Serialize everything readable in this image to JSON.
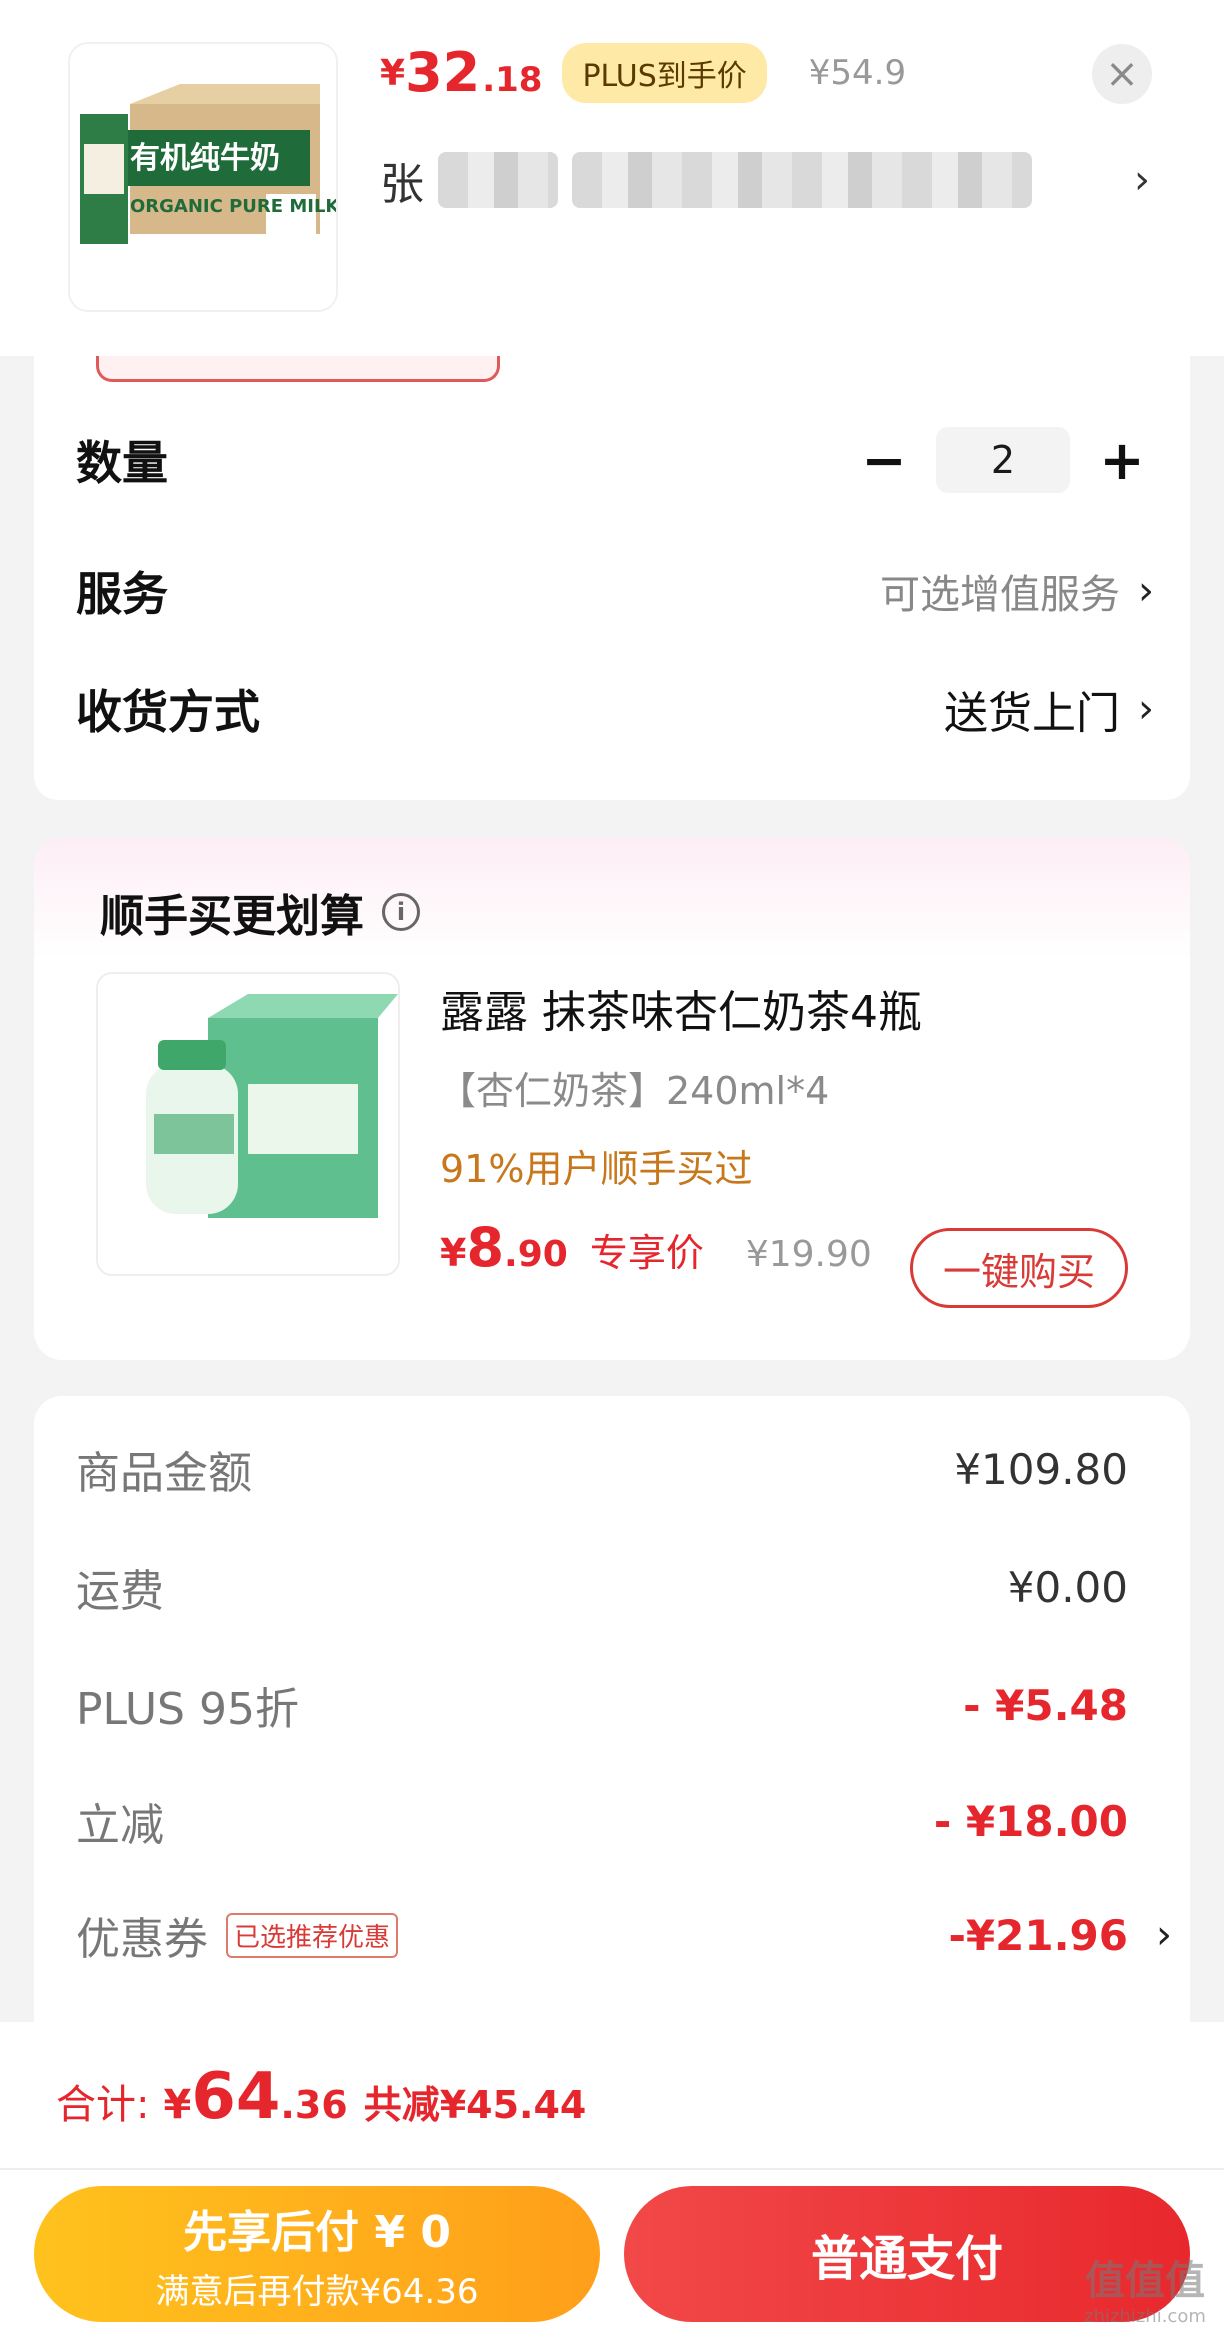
{
  "product": {
    "currency": "¥",
    "price_int": "32",
    "price_dec": ".18",
    "plus_tag": "PLUS到手价",
    "original_price": "¥54.9",
    "title_start": "张",
    "close_icon": "close-icon",
    "chevron": "›",
    "image_label": "有机纯牛奶",
    "image_label2": "ORGANIC PURE MILK"
  },
  "options": {
    "quantity_label": "数量",
    "quantity_value": "2",
    "minus": "−",
    "plus": "+",
    "service_label": "服务",
    "service_value": "可选增值服务",
    "delivery_label": "收货方式",
    "delivery_value": "送货上门",
    "chevron": "›"
  },
  "upsell": {
    "title": "顺手买更划算",
    "info_icon": "i",
    "name": "露露 抹茶味杏仁奶茶4瓶",
    "spec": "【杏仁奶茶】240ml*4",
    "note": "91%用户顺手买过",
    "currency": "¥",
    "price_int": "8",
    "price_dec": ".90",
    "exclusive_label": "专享价",
    "original_price": "¥19.90",
    "buy_button": "一键购买"
  },
  "summary": {
    "rows": [
      {
        "label": "商品金额",
        "value": "¥109.80"
      },
      {
        "label": "运费",
        "value": "¥0.00"
      },
      {
        "label": "PLUS 95折",
        "value": "- ¥5.48"
      },
      {
        "label": "立减",
        "value": "- ¥18.00"
      },
      {
        "label": "优惠券",
        "value": "-¥21.96"
      }
    ],
    "coupon_tag": "已选推荐优惠",
    "chevron": "›"
  },
  "footer": {
    "total_label": "合计:",
    "currency": "¥",
    "total_int": "64",
    "total_dec": ".36",
    "discount": "共减¥45.44",
    "pay_later_title": "先享后付 ¥ 0",
    "pay_later_sub": "满意后再付款¥64.36",
    "pay_button": "普通支付"
  },
  "watermark": {
    "line1": "值值值",
    "line2": "zhizhizhi.com"
  },
  "colors": {
    "accent_red": "#e6262d",
    "plus_gold": "#ffe9a6",
    "pay_later_yellow": "#ffb01c",
    "note_orange": "#c8781c"
  }
}
